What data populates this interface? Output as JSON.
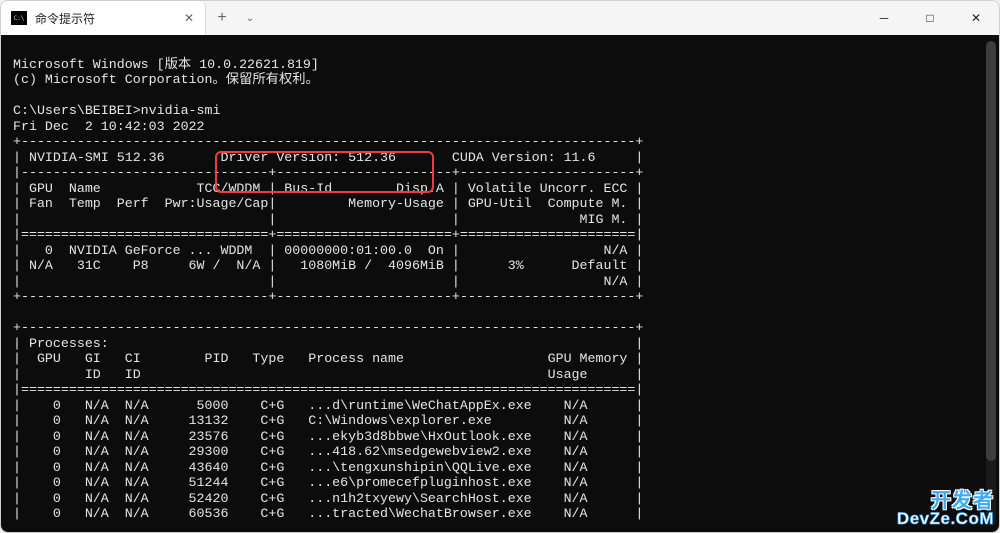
{
  "tab": {
    "title": "命令提示符"
  },
  "window_controls": {
    "minimize": "─",
    "maximize": "□",
    "close": "✕"
  },
  "header_lines": [
    "",
    "Microsoft Windows [版本 10.0.22621.819]",
    "(c) Microsoft Corporation。保留所有权利。",
    "",
    "C:\\Users\\BEIBEI>nvidia-smi",
    "Fri Dec  2 10:42:03 2022"
  ],
  "nvsmi": {
    "border_top": "+-----------------------------------------------------------------------------+",
    "version_line": "| NVIDIA-SMI 512.36       Driver Version: 512.36       CUDA Version: 11.6     |",
    "sep": "|-------------------------------+----------------------+----------------------+",
    "hdr1": "| GPU  Name            TCC/WDDM | Bus-Id        Disp.A | Volatile Uncorr. ECC |",
    "hdr2": "| Fan  Temp  Perf  Pwr:Usage/Cap|         Memory-Usage | GPU-Util  Compute M. |",
    "hdr3": "|                               |                      |               MIG M. |",
    "sep2": "|===============================+======================+======================|",
    "gpu1": "|   0  NVIDIA GeForce ... WDDM  | 00000000:01:00.0  On |                  N/A |",
    "gpu2": "| N/A   31C    P8     6W /  N/A |   1080MiB /  4096MiB |      3%      Default |",
    "gpu3": "|                               |                      |                  N/A |",
    "border_mid": "+-------------------------------+----------------------+----------------------+",
    "blank": "",
    "ptop": "+-----------------------------------------------------------------------------+",
    "phead": "| Processes:                                                                  |",
    "pcol1": "|  GPU   GI   CI        PID   Type   Process name                  GPU Memory |",
    "pcol2": "|        ID   ID                                                   Usage      |",
    "psep": "|=============================================================================|"
  },
  "processes": [
    "|    0   N/A  N/A      5000    C+G   ...d\\runtime\\WeChatAppEx.exe    N/A      |",
    "|    0   N/A  N/A     13132    C+G   C:\\Windows\\explorer.exe         N/A      |",
    "|    0   N/A  N/A     23576    C+G   ...ekyb3d8bbwe\\HxOutlook.exe    N/A      |",
    "|    0   N/A  N/A     29300    C+G   ...418.62\\msedgewebview2.exe    N/A      |",
    "|    0   N/A  N/A     43640    C+G   ...\\tengxunshipin\\QQLive.exe    N/A      |",
    "|    0   N/A  N/A     51244    C+G   ...e6\\promecefpluginhost.exe    N/A      |",
    "|    0   N/A  N/A     52420    C+G   ...n1h2txyewy\\SearchHost.exe    N/A      |",
    "|    0   N/A  N/A     60536    C+G   ...tracted\\WechatBrowser.exe    N/A      |"
  ],
  "watermark": {
    "cn": "开发者",
    "en": "DevZe.CoM"
  }
}
